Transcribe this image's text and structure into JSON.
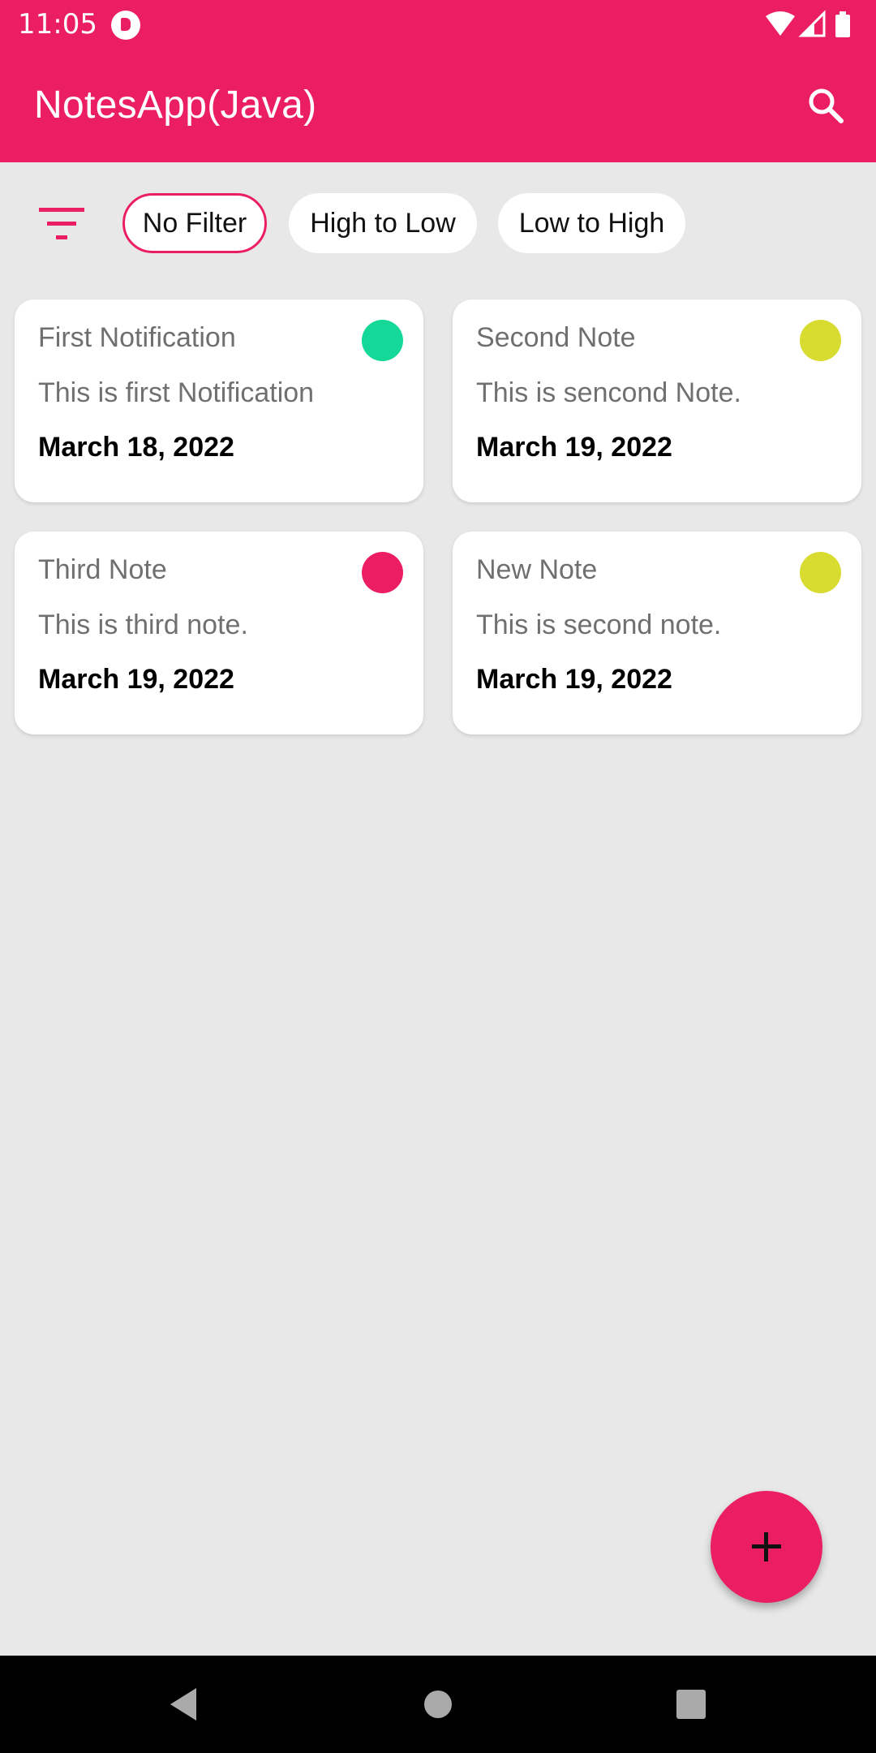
{
  "status_bar": {
    "time": "11:05"
  },
  "app_bar": {
    "title": "NotesApp(Java)",
    "search_icon": "search-icon",
    "background": "#ec1e63"
  },
  "filters": {
    "icon": "filter-icon",
    "chips": [
      {
        "label": "No Filter",
        "selected": true
      },
      {
        "label": "High to Low",
        "selected": false
      },
      {
        "label": "Low to High",
        "selected": false
      }
    ]
  },
  "notes": [
    {
      "title": "First Notification",
      "body": "This is first Notification",
      "date": "March 18, 2022",
      "priority_color": "#13d897"
    },
    {
      "title": "Second Note",
      "body": "This is sencond Note.",
      "date": "March 19, 2022",
      "priority_color": "#d8dc30"
    },
    {
      "title": "Third Note",
      "body": "This is third note.",
      "date": "March 19, 2022",
      "priority_color": "#ec1e63"
    },
    {
      "title": "New Note",
      "body": "This is second note.",
      "date": "March 19, 2022",
      "priority_color": "#d8dc30"
    }
  ],
  "fab": {
    "icon": "add-icon",
    "background": "#ec1e63"
  },
  "navigation_bar": {
    "icons": [
      "back-icon",
      "home-icon",
      "recents-icon"
    ]
  }
}
